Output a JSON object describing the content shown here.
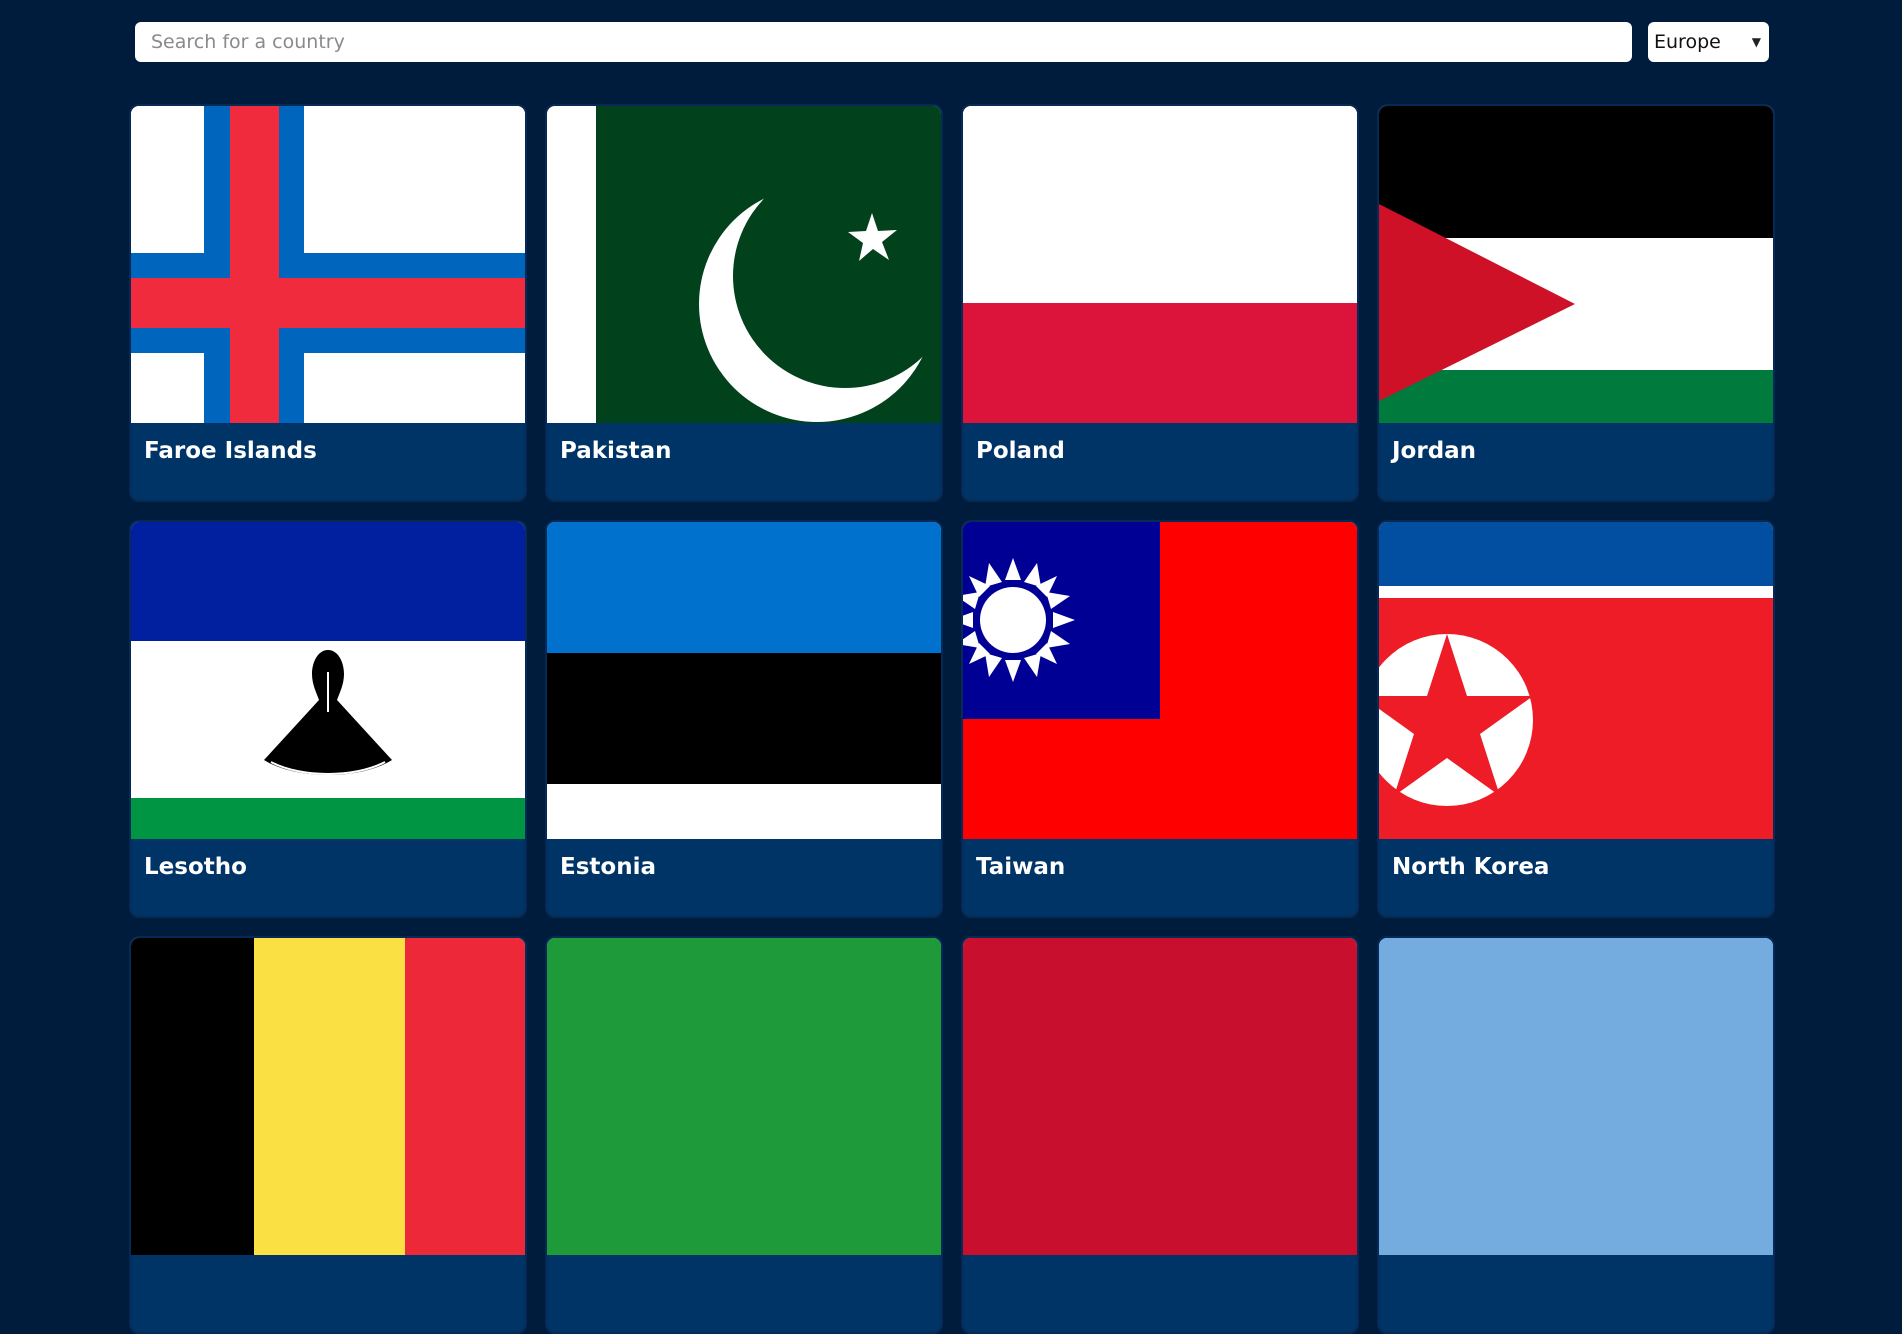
{
  "search": {
    "placeholder": "Search for a country",
    "value": ""
  },
  "region_filter": {
    "selected": "Europe"
  },
  "countries": [
    {
      "name": "Faroe Islands",
      "flag": "faroe-islands-flag"
    },
    {
      "name": "Pakistan",
      "flag": "pakistan-flag"
    },
    {
      "name": "Poland",
      "flag": "poland-flag"
    },
    {
      "name": "Jordan",
      "flag": "jordan-flag"
    },
    {
      "name": "Lesotho",
      "flag": "lesotho-flag"
    },
    {
      "name": "Estonia",
      "flag": "estonia-flag"
    },
    {
      "name": "Taiwan",
      "flag": "taiwan-flag"
    },
    {
      "name": "North Korea",
      "flag": "north-korea-flag"
    },
    {
      "name": "",
      "flag": "belgium-flag"
    },
    {
      "name": "",
      "flag": "green-flag"
    },
    {
      "name": "",
      "flag": "red-flag"
    },
    {
      "name": "",
      "flag": "light-blue-flag"
    }
  ],
  "colors": {
    "background": "#001c3d",
    "card": "#003366",
    "text": "#ffffff"
  }
}
